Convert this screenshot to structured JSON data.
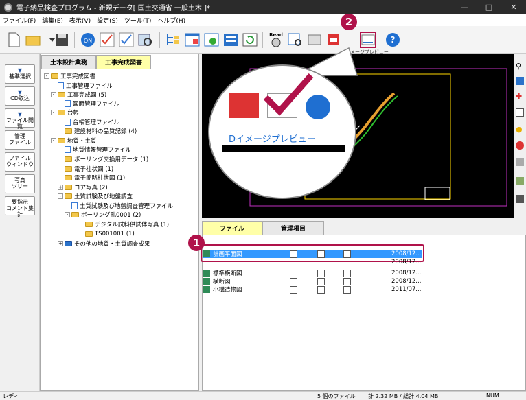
{
  "window": {
    "title": "電子納品検査プログラム - 新規データ[ 国土交通省 一般土木 ]*"
  },
  "menu": [
    "ファイル(F)",
    "編集(E)",
    "表示(V)",
    "設定(S)",
    "ツール(T)",
    "ヘルプ(H)"
  ],
  "sidebar": [
    {
      "label": "基準選択"
    },
    {
      "label": "CD取込"
    },
    {
      "label": "ファイル閲覧"
    },
    {
      "label": "管理\nファイル"
    },
    {
      "label": "ファイル\nウィンドウ"
    },
    {
      "label": "写真\nツリー"
    },
    {
      "label": "要指示\nコメント集計"
    }
  ],
  "tree_tabs": [
    "土木設計業務",
    "工事完成図書"
  ],
  "tree": [
    "工事完成図書",
    "工事管理ファイル",
    "工事完成図 (5)",
    "図面管理ファイル",
    "台帳",
    "台帳管理ファイル",
    "建設材料の品質記録 (4)",
    "地質・土質",
    "地質情報管理ファイル",
    "ボーリング交換用データ (1)",
    "電子柱状図 (1)",
    "電子簡略柱状図 (1)",
    "コア写真 (2)",
    "土質試験及び地盤調査",
    "土質試験及び地盤調査管理ファイル",
    "ボーリング孔0001 (2)",
    "デジタル試料供試体写真 (1)",
    "TS001001 (1)",
    "その他の地質・土質調査成果"
  ],
  "list_tabs": [
    "ファイル",
    "管理項目"
  ],
  "files": [
    {
      "name": "計画平面図",
      "date": "2008/12..."
    },
    {
      "name": "",
      "date": "2008/12..."
    },
    {
      "name": "標準横断図",
      "date": "2008/12..."
    },
    {
      "name": "横断図",
      "date": "2008/12..."
    },
    {
      "name": "小構造物図",
      "date": "2011/07..."
    }
  ],
  "callout": {
    "label": "Dイメージプレビュー",
    "label_small": "メージプレビュー"
  },
  "toolbar": {
    "read_label": "Read"
  },
  "badges": [
    "1",
    "2"
  ],
  "status": {
    "left": "レディ",
    "count": "5 個のファイル",
    "size": "計 2.32 MB / 総計 4.04 MB",
    "num": "NUM"
  },
  "colors": {
    "badge": "#b0124a",
    "highlight": "#3399ff",
    "tab_active": "#ffffa8"
  }
}
